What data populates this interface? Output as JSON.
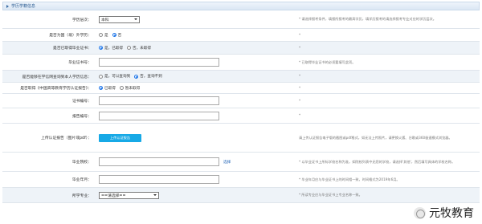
{
  "header": {
    "title": "学历学籍信息"
  },
  "rows": {
    "degree": {
      "label": "学历层次：",
      "selected": "本科",
      "tip": "* 请选择报考条件，填报所报考的最高学历，填学历报考的请选择报考专业对应的学历层次。"
    },
    "overseas": {
      "label": "是否为国（境）外学历：",
      "opt1": "是",
      "opt2": "否",
      "tip": "*"
    },
    "certificate": {
      "label": "是否已取得毕业证书：",
      "opt1": "是，已取得",
      "opt2": "否，未取得",
      "tip": "*"
    },
    "cert_no": {
      "label": "毕业证书号：",
      "tip": "* 已取得毕业证书的必须要填写此项。"
    },
    "chsi": {
      "label": "是否能够在学信网查询到本人学历信息：",
      "opt1": "是，可以查询到",
      "opt2": "否，查询不到",
      "tip": "*"
    },
    "verify": {
      "label": "是否取得《中国高等教育学历认证报告》：",
      "opt1": "已取得",
      "opt2": "暂未取得",
      "tip": "*"
    },
    "cert_number": {
      "label": "证书编号：",
      "tip": "*"
    },
    "report_number": {
      "label": "报告编号：",
      "tip": "*"
    },
    "upload": {
      "label": "上传认证报告（图片或pdf）：",
      "button": "上传认证报告",
      "tip": "请上传认证报告电子版的截图或pdf格式，如无法上传照片，请更换火狐、谷歌或360极速模式浏览器。"
    },
    "school": {
      "label": "毕业院校：",
      "link": "选择",
      "tip": "* 以毕业证书上所标学校名称为准，如院校列表中无您的学校，请选择'其他'，然后填写具体的学校名称。"
    },
    "grad_date": {
      "label": "毕业年月：",
      "tip": "* 毕业年月应与毕业证书上的时间相一致，时间格式为2019年6月。"
    },
    "major": {
      "label": "所学专业：",
      "selected": "==请选择==",
      "tip": "* 所读专业应与毕业证书上专业名称一致。"
    }
  },
  "watermark": {
    "text": "元牧教育"
  }
}
